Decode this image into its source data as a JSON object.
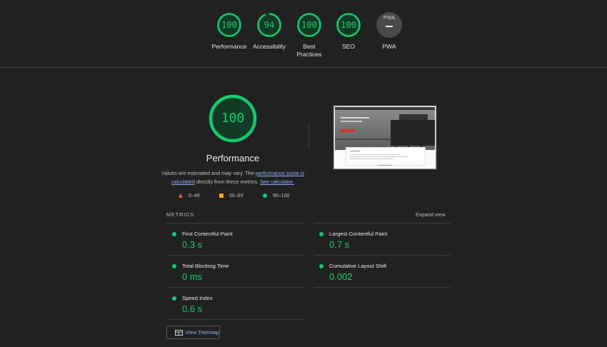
{
  "summary": {
    "categories": [
      {
        "label": "Performance",
        "score": "100",
        "value": 100
      },
      {
        "label": "Accessibility",
        "score": "94",
        "value": 94
      },
      {
        "label": "Best Practices",
        "score": "100",
        "value": 100,
        "label_lines": [
          "Best",
          "Practices"
        ]
      },
      {
        "label": "SEO",
        "score": "100",
        "value": 100
      },
      {
        "label": "PWA",
        "badge_text": "PWA"
      }
    ]
  },
  "performance": {
    "score": "100",
    "title": "Performance",
    "note": {
      "prefix": "Values are estimated and may vary. The ",
      "link1": "performance score is calculated",
      "middle": " directly from these metrics. ",
      "link2": "See calculator."
    },
    "legend": [
      {
        "range": "0–49",
        "color": "#ff4e42",
        "icon": "fail-triangle-icon"
      },
      {
        "range": "50–89",
        "color": "#ffa400",
        "icon": "average-square-icon"
      },
      {
        "range": "90–100",
        "color": "#0cce6b",
        "icon": "pass-circle-icon"
      }
    ]
  },
  "metrics": {
    "heading": "METRICS",
    "expand_label": "Expand view",
    "items": [
      {
        "name": "First Contentful Paint",
        "value": "0.3 s"
      },
      {
        "name": "Largest Contentful Paint",
        "value": "0.7 s"
      },
      {
        "name": "Total Blocking Time",
        "value": "0 ms"
      },
      {
        "name": "Cumulative Layout Shift",
        "value": "0.002"
      },
      {
        "name": "Speed Index",
        "value": "0.6 s"
      }
    ]
  },
  "treemap_button": {
    "label": "View Treemap",
    "icon": "treemap-icon"
  },
  "colors": {
    "pass": "#0cce6b",
    "average": "#ffa400",
    "fail": "#ff4e42",
    "link": "#8ab4f8",
    "background": "#212121"
  }
}
